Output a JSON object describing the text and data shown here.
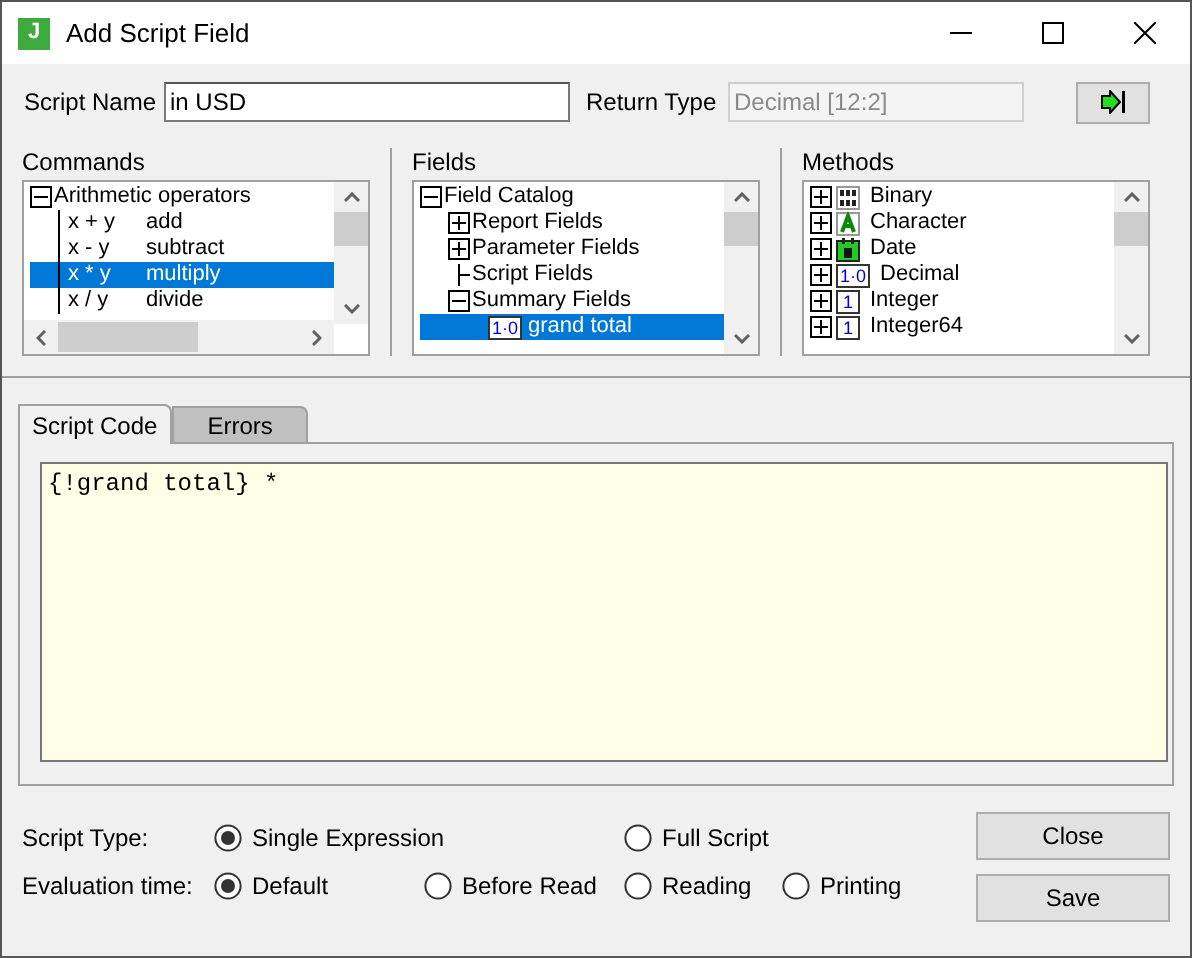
{
  "window": {
    "title": "Add Script Field",
    "app_icon": "J"
  },
  "script_name": {
    "label": "Script Name",
    "value": "in USD"
  },
  "return_type": {
    "label": "Return Type",
    "value": "Decimal [12:2]",
    "disabled": true
  },
  "commands": {
    "label": "Commands",
    "tree": [
      {
        "label": "Arithmetic operators",
        "expanded": true,
        "children": [
          {
            "expr": "x + y",
            "label": "add",
            "selected": false
          },
          {
            "expr": "x - y",
            "label": "subtract",
            "selected": false
          },
          {
            "expr": "x * y",
            "label": "multiply",
            "selected": true
          },
          {
            "expr": "x / y",
            "label": "divide",
            "selected": false
          }
        ]
      }
    ]
  },
  "fields": {
    "label": "Fields",
    "tree": [
      {
        "label": "Field Catalog",
        "expanded": true,
        "children": [
          {
            "label": "Report Fields",
            "expanded": false,
            "has_children": true,
            "selected": false
          },
          {
            "label": "Parameter Fields",
            "expanded": false,
            "has_children": true,
            "selected": false
          },
          {
            "label": "Script Fields",
            "has_children": false,
            "selected": false
          },
          {
            "label": "Summary Fields",
            "expanded": true,
            "has_children": true,
            "selected": false,
            "children": [
              {
                "label": "grand total",
                "badge": "1·0",
                "selected": true
              }
            ]
          }
        ]
      }
    ]
  },
  "methods": {
    "label": "Methods",
    "items": [
      {
        "kind": "binary",
        "label": "Binary"
      },
      {
        "kind": "character",
        "label": "Character"
      },
      {
        "kind": "date",
        "label": "Date"
      },
      {
        "kind": "decimal",
        "badge": "1·0",
        "label": "Decimal"
      },
      {
        "kind": "integer",
        "badge": "1",
        "label": "Integer"
      },
      {
        "kind": "integer",
        "badge": "1",
        "label": "Integer64"
      }
    ]
  },
  "tabs": [
    {
      "label": "Script Code",
      "selected": true
    },
    {
      "label": "Errors",
      "selected": false
    }
  ],
  "code": "{!grand total} *",
  "script_type": {
    "label": "Script Type:",
    "options": [
      {
        "label": "Single Expression",
        "selected": true
      },
      {
        "label": "Full Script",
        "selected": false
      }
    ]
  },
  "evaluation_time": {
    "label": "Evaluation time:",
    "options": [
      {
        "label": "Default",
        "selected": true
      },
      {
        "label": "Before Read",
        "selected": false
      },
      {
        "label": "Reading",
        "selected": false
      },
      {
        "label": "Printing",
        "selected": false
      }
    ]
  },
  "buttons": [
    "Close",
    "Save"
  ]
}
